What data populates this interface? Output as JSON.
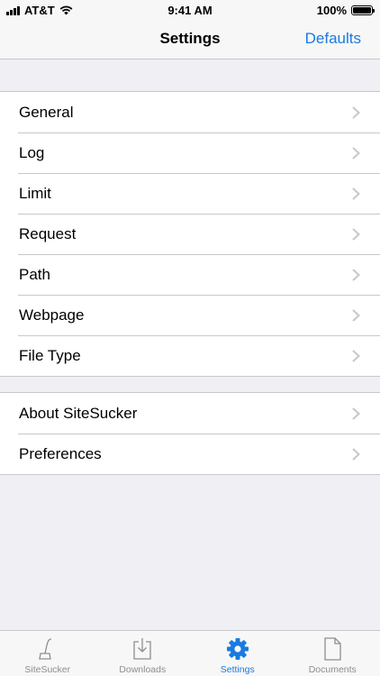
{
  "status_bar": {
    "carrier": "AT&T",
    "time": "9:41 AM",
    "battery": "100%"
  },
  "nav": {
    "title": "Settings",
    "defaults_label": "Defaults"
  },
  "group1": {
    "items": [
      {
        "label": "General"
      },
      {
        "label": "Log"
      },
      {
        "label": "Limit"
      },
      {
        "label": "Request"
      },
      {
        "label": "Path"
      },
      {
        "label": "Webpage"
      },
      {
        "label": "File Type"
      }
    ]
  },
  "group2": {
    "items": [
      {
        "label": "About SiteSucker"
      },
      {
        "label": "Preferences"
      }
    ]
  },
  "tabs": [
    {
      "label": "SiteSucker",
      "icon": "vacuum-icon"
    },
    {
      "label": "Downloads",
      "icon": "download-tray-icon"
    },
    {
      "label": "Settings",
      "icon": "gear-icon",
      "active": true
    },
    {
      "label": "Documents",
      "icon": "document-icon"
    }
  ],
  "colors": {
    "accent": "#1a7ae0",
    "background": "#efeff4",
    "inactive_tab": "#8e8e93"
  }
}
